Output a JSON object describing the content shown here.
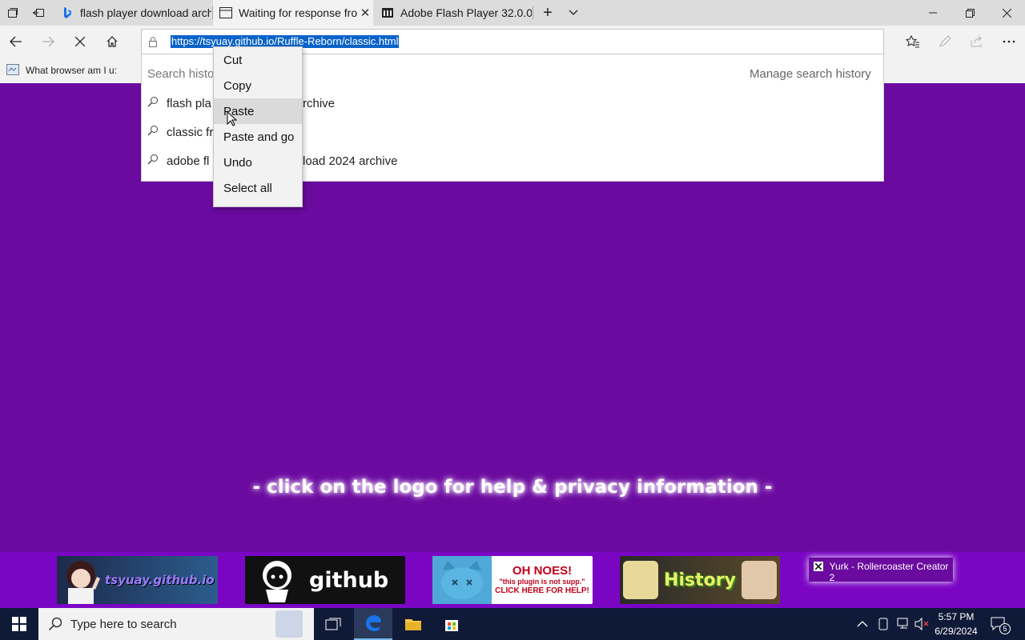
{
  "tabs": [
    {
      "title": "flash player download archi",
      "favicon": "bing-icon"
    },
    {
      "title": "Waiting for response fro",
      "favicon": "page-icon",
      "active": true
    },
    {
      "title": "Adobe Flash Player 32.0.0.3",
      "favicon": "archive-icon"
    }
  ],
  "address_bar": {
    "url_selected": "https://tsyuay.github.io/Ruffle-Reborn/classic.html"
  },
  "favorites_bar": {
    "item": "What browser am I u:"
  },
  "dropdown": {
    "search_history_label": "Search histo",
    "manage_label": "Manage search history",
    "suggestions": [
      {
        "left": "flash pla",
        "right": "rchive"
      },
      {
        "left": "classic fr",
        "right": ""
      },
      {
        "left": "adobe fl",
        "right": "load 2024 archive"
      }
    ]
  },
  "context_menu": {
    "items": [
      "Cut",
      "Copy",
      "Paste",
      "Paste and go",
      "Undo",
      "Select all"
    ],
    "hovered": "Paste"
  },
  "page": {
    "help_text": "- click on the logo for help & privacy information -",
    "banners": {
      "tsyuay": "tsyuay.github.io",
      "github": "github",
      "oh_noes_title": "OH NOES!",
      "oh_noes_sub": "\"this plugin is not supp.\"",
      "oh_noes_cta": "CLICK HERE FOR HELP!",
      "history": "History"
    },
    "popup_text": "Yurk - Rollercoaster Creator 2"
  },
  "taskbar": {
    "search_placeholder": "Type here to search",
    "time": "5:57 PM",
    "date": "6/29/2024",
    "notification_count": "5"
  },
  "colors": {
    "page_bg": "#6a0a9f",
    "url_selection": "#0a63c9",
    "edge_blue": "#1a73e8"
  }
}
